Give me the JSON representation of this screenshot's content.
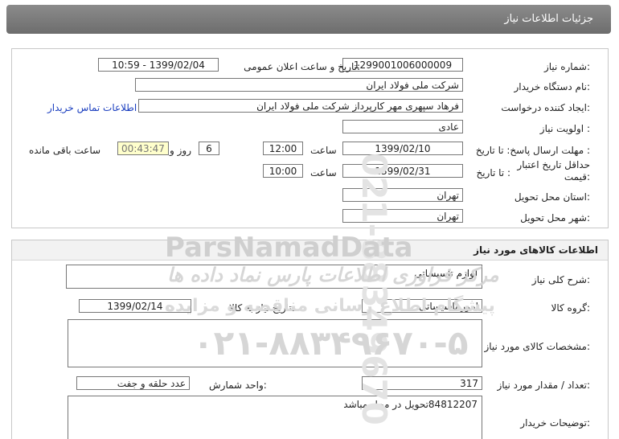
{
  "header": {
    "title": "جزئیات اطلاعات نیاز"
  },
  "need_info": {
    "need_number_label": "شماره نیاز:",
    "need_number": "1299001006000009",
    "announce_label": "تاریخ و ساعت اعلان عمومی:",
    "announce_value": "1399/02/04 - 10:59",
    "buyer_org_label": "نام دستگاه خریدار:",
    "buyer_org": "شرکت ملی فولاد ایران",
    "requester_label": "ایجاد کننده درخواست:",
    "requester": "فرهاد سپهری مهر کارپرداز شرکت ملی فولاد ایران",
    "contact_link": "اطلاعات تماس خریدار",
    "priority_label": "اولویت نیاز :",
    "priority": "عادی",
    "reply_deadline_label": "مهلت ارسال پاسخ: تا تاریخ :",
    "reply_date": "1399/02/10",
    "time_label": "ساعت",
    "reply_time": "12:00",
    "days": "6",
    "days_label": "روز و",
    "remaining_time": "00:43:47",
    "remaining_label": "ساعت باقی مانده",
    "validity_label_1": "حداقل تاریخ اعتبار",
    "validity_label_2": "قیمت:",
    "to_date_label": "تا تاریخ :",
    "validity_date": "1399/02/31",
    "validity_time_label": "ساعت",
    "validity_time": "10:00",
    "province_label": "استان محل تحویل:",
    "province": "تهران",
    "city_label": "شهر محل تحویل:",
    "city": "تهران"
  },
  "goods": {
    "section_title": "اطلاعات کالاهای مورد نیاز",
    "desc_label": "شرح کلی نیاز:",
    "desc": "لوازم تاسیساتی",
    "group_label": "گروه کالا:",
    "group": "امور تاسیساتی",
    "need_date_label": "تاریخ نیاز به کالا:",
    "need_date": "1399/02/14",
    "spec_label": "مشخصات کالای مورد نیاز:",
    "spec": "",
    "qty_label": "تعداد / مقدار مورد نیاز:",
    "qty": "317",
    "unit_label": "واحد شمارش:",
    "unit": "عدد حلقه و جفت",
    "notes_label": "توضیحات خریدار:",
    "notes": "84812207تحویل در محل مباشد"
  },
  "watermark": {
    "phone_vertical": "021-88349670",
    "brand": "ParsNamadData",
    "line1": "مرکز فراوری اطلاعات پارس نماد داده ها",
    "line2": "پیشگام اطلاع رسانی مناقصه و مزایده",
    "phone": "۰۲۱-۸۸۳۴۹۶۷۰-۵"
  }
}
